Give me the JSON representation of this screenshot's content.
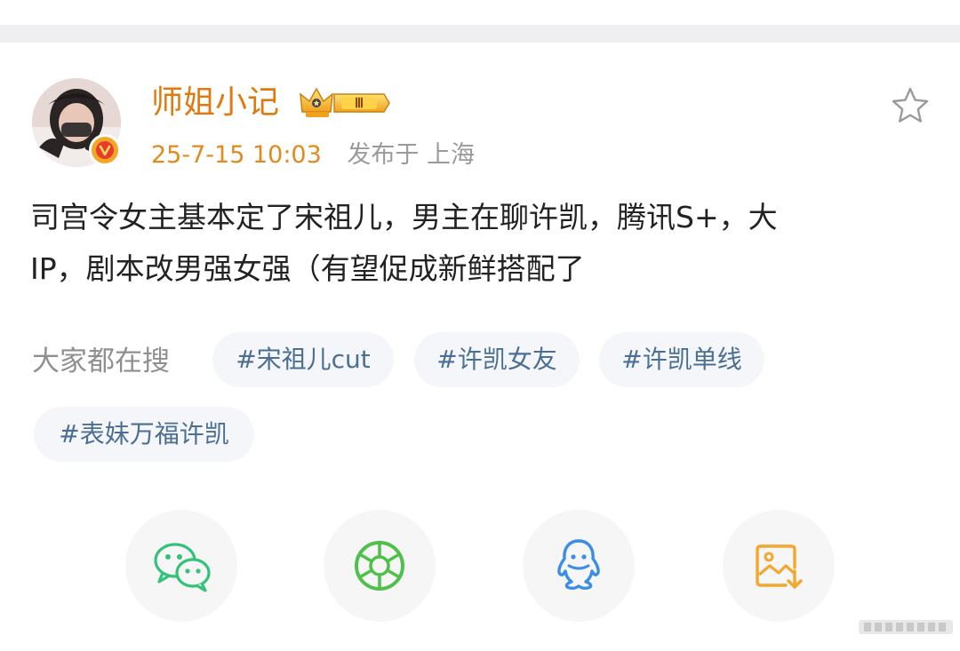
{
  "post": {
    "author": "师姐小记",
    "level_badge": "Ⅲ",
    "time": "25-7-15 10:03",
    "location": "发布于 上海",
    "text_line1": "司宫令女主基本定了宋祖儿，男主在聊许凯，腾讯S+，大",
    "text_line2": "IP，剧本改男强女强（有望促成新鲜搭配了"
  },
  "search": {
    "label": "大家都在搜",
    "tags": [
      "#宋祖儿cut",
      "#许凯女友",
      "#许凯单线",
      "#表妹万福许凯"
    ]
  },
  "share": {
    "icons": [
      "wechat-icon",
      "moments-icon",
      "qq-icon",
      "save-image-icon"
    ]
  },
  "colors": {
    "author": "#e07a10",
    "time": "#e08a20",
    "tag_text": "#4a6f93",
    "tag_bg": "#f4f6f9",
    "wechat": "#34c27a",
    "moments": "#4fc04a",
    "qq": "#3a8ee6",
    "save": "#f2a72e"
  }
}
